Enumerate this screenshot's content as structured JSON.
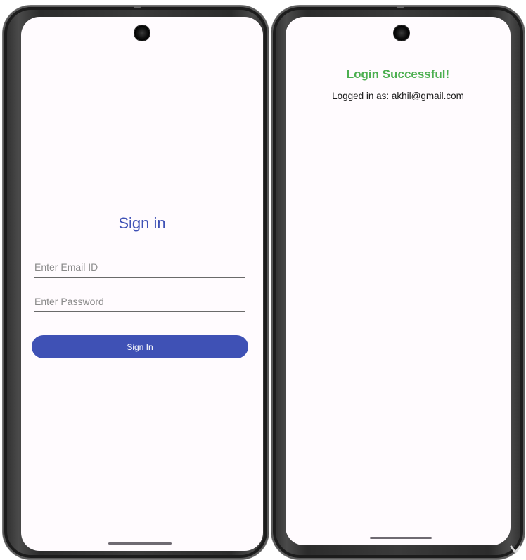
{
  "signin_screen": {
    "title": "Sign in",
    "email_placeholder": "Enter Email ID",
    "email_value": "",
    "password_placeholder": "Enter Password",
    "password_value": "",
    "button_label": "Sign In"
  },
  "success_screen": {
    "title": "Login Successful!",
    "logged_in_text": "Logged in as: akhil@gmail.com"
  },
  "colors": {
    "primary": "#3f51b5",
    "success": "#4caf50",
    "screen_background": "#fffbfe",
    "frame": "#2c2c2c"
  },
  "icons": {
    "camera": "camera-icon",
    "home_indicator": "home-indicator"
  }
}
